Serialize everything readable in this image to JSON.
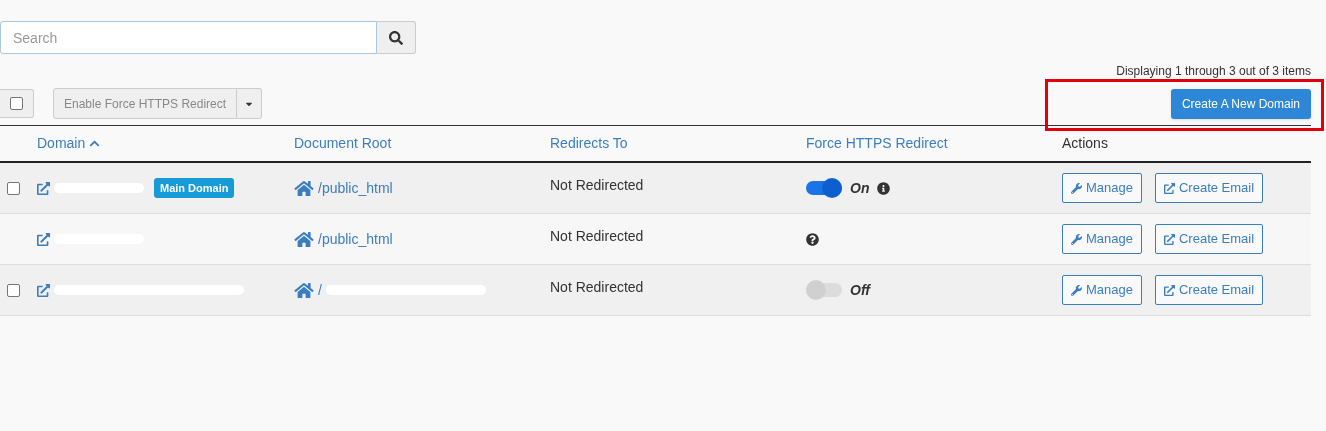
{
  "search": {
    "placeholder": "Search"
  },
  "toolbar": {
    "select_all": {
      "checked": false
    },
    "bulk_action": {
      "label": "Enable Force HTTPS Redirect",
      "disabled": true
    }
  },
  "pagination": {
    "summary": "Displaying 1 through 3 out of 3 items"
  },
  "create_button": {
    "label": "Create A New Domain",
    "highlighted": true
  },
  "table": {
    "columns": [
      {
        "label": "Domain",
        "sortable": true
      },
      {
        "label": "Document Root",
        "sortable": true
      },
      {
        "label": "Redirects To",
        "sortable": true
      },
      {
        "label": "Force HTTPS Redirect",
        "sortable": true
      },
      {
        "label": "Actions",
        "sortable": false
      }
    ],
    "rows": [
      {
        "checked": false,
        "badge": "Main Domain",
        "document_root": "/public_html",
        "root_redacted": false,
        "redirects_to": "Not Redirected",
        "https": {
          "kind": "toggle",
          "on": true,
          "label": "On",
          "info": true
        },
        "actions": [
          "Manage",
          "Create Email"
        ]
      },
      {
        "document_root": "/public_html",
        "root_redacted": false,
        "redirects_to": "Not Redirected",
        "https": {
          "kind": "help"
        },
        "actions": [
          "Manage",
          "Create Email"
        ]
      },
      {
        "checked": false,
        "document_root": "/",
        "root_redacted": true,
        "redirects_to": "Not Redirected",
        "https": {
          "kind": "toggle",
          "on": false,
          "label": "Off",
          "info": false
        },
        "actions": [
          "Manage",
          "Create Email"
        ]
      }
    ]
  }
}
